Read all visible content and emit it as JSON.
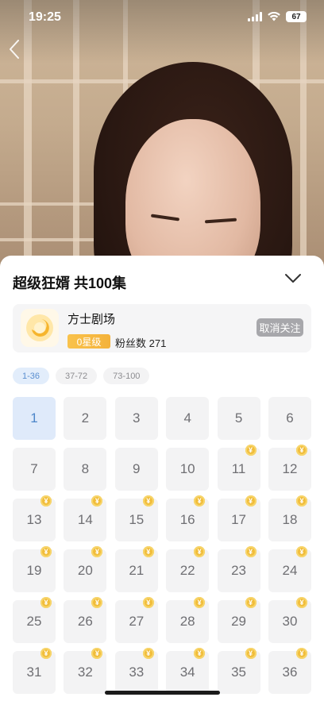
{
  "status_bar": {
    "time": "19:25",
    "battery": "67"
  },
  "sheet": {
    "title": "超级狂婿 共100集",
    "channel": {
      "name": "方士剧场",
      "level": "0星级",
      "fans": "粉丝数 271",
      "unfollow_label": "取消关注"
    },
    "ranges": [
      {
        "label": "1-36",
        "active": true
      },
      {
        "label": "37-72",
        "active": false
      },
      {
        "label": "73-100",
        "active": false
      }
    ],
    "episodes": [
      "1",
      "2",
      "3",
      "4",
      "5",
      "6",
      "7",
      "8",
      "9",
      "10",
      "11",
      "12",
      "13",
      "14",
      "15",
      "16",
      "17",
      "18",
      "19",
      "20",
      "21",
      "22",
      "23",
      "24",
      "25",
      "26",
      "27",
      "28",
      "29",
      "30",
      "31",
      "32",
      "33",
      "34",
      "35",
      "36"
    ],
    "active_episode": "1",
    "first_paid_episode": 11,
    "coin_symbol": "¥"
  },
  "colors": {
    "accent": "#4d86c9",
    "coin": "#f1bd3a",
    "badge": "#f4b23a"
  },
  "icons": [
    "back-icon",
    "collapse-chevron-icon",
    "coin-icon",
    "signal-icon",
    "wifi-icon",
    "battery-icon"
  ]
}
